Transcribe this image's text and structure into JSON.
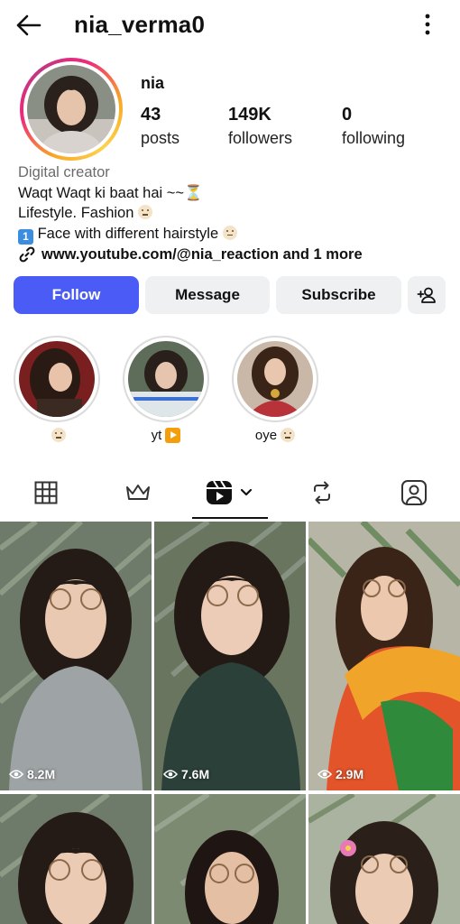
{
  "header": {
    "username": "nia_verma0"
  },
  "profile": {
    "display_name": "nia",
    "stats": [
      {
        "value": "43",
        "label": "posts"
      },
      {
        "value": "149K",
        "label": "followers"
      },
      {
        "value": "0",
        "label": "following"
      }
    ],
    "category": "Digital creator",
    "bio_line1": "Waqt Waqt ki baat hai ~~⏳",
    "bio_line2": "Lifestyle. Fashion",
    "bio_line3_key": "1",
    "bio_line3": "Face with different hairstyle",
    "link": "www.youtube.com/@nia_reaction and 1 more"
  },
  "actions": {
    "follow": "Follow",
    "message": "Message",
    "subscribe": "Subscribe"
  },
  "highlights": [
    {
      "caption": ""
    },
    {
      "caption": "yt"
    },
    {
      "caption": "oye"
    }
  ],
  "tabs": [
    "grid",
    "collabs",
    "reels",
    "reposts",
    "tagged"
  ],
  "active_tab": "reels",
  "reels": [
    {
      "views": "8.2M"
    },
    {
      "views": "7.6M"
    },
    {
      "views": "2.9M"
    },
    {
      "views": ""
    },
    {
      "views": ""
    },
    {
      "views": ""
    }
  ],
  "colors": {
    "accent": "#4a5cf5",
    "button_bg": "#eff0f2"
  }
}
